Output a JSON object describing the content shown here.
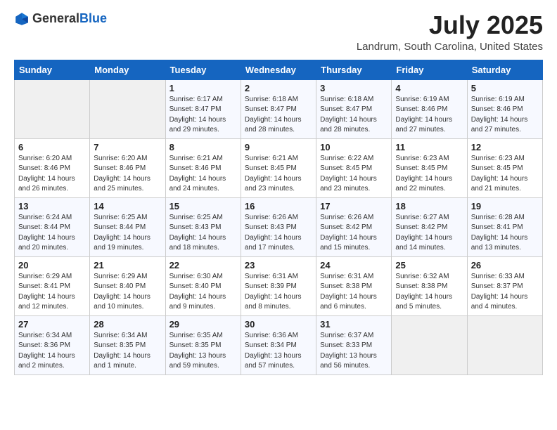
{
  "header": {
    "logo_general": "General",
    "logo_blue": "Blue",
    "month": "July 2025",
    "location": "Landrum, South Carolina, United States"
  },
  "days_of_week": [
    "Sunday",
    "Monday",
    "Tuesday",
    "Wednesday",
    "Thursday",
    "Friday",
    "Saturday"
  ],
  "weeks": [
    [
      {
        "day": "",
        "info": ""
      },
      {
        "day": "",
        "info": ""
      },
      {
        "day": "1",
        "info": "Sunrise: 6:17 AM\nSunset: 8:47 PM\nDaylight: 14 hours\nand 29 minutes."
      },
      {
        "day": "2",
        "info": "Sunrise: 6:18 AM\nSunset: 8:47 PM\nDaylight: 14 hours\nand 28 minutes."
      },
      {
        "day": "3",
        "info": "Sunrise: 6:18 AM\nSunset: 8:47 PM\nDaylight: 14 hours\nand 28 minutes."
      },
      {
        "day": "4",
        "info": "Sunrise: 6:19 AM\nSunset: 8:46 PM\nDaylight: 14 hours\nand 27 minutes."
      },
      {
        "day": "5",
        "info": "Sunrise: 6:19 AM\nSunset: 8:46 PM\nDaylight: 14 hours\nand 27 minutes."
      }
    ],
    [
      {
        "day": "6",
        "info": "Sunrise: 6:20 AM\nSunset: 8:46 PM\nDaylight: 14 hours\nand 26 minutes."
      },
      {
        "day": "7",
        "info": "Sunrise: 6:20 AM\nSunset: 8:46 PM\nDaylight: 14 hours\nand 25 minutes."
      },
      {
        "day": "8",
        "info": "Sunrise: 6:21 AM\nSunset: 8:46 PM\nDaylight: 14 hours\nand 24 minutes."
      },
      {
        "day": "9",
        "info": "Sunrise: 6:21 AM\nSunset: 8:45 PM\nDaylight: 14 hours\nand 23 minutes."
      },
      {
        "day": "10",
        "info": "Sunrise: 6:22 AM\nSunset: 8:45 PM\nDaylight: 14 hours\nand 23 minutes."
      },
      {
        "day": "11",
        "info": "Sunrise: 6:23 AM\nSunset: 8:45 PM\nDaylight: 14 hours\nand 22 minutes."
      },
      {
        "day": "12",
        "info": "Sunrise: 6:23 AM\nSunset: 8:45 PM\nDaylight: 14 hours\nand 21 minutes."
      }
    ],
    [
      {
        "day": "13",
        "info": "Sunrise: 6:24 AM\nSunset: 8:44 PM\nDaylight: 14 hours\nand 20 minutes."
      },
      {
        "day": "14",
        "info": "Sunrise: 6:25 AM\nSunset: 8:44 PM\nDaylight: 14 hours\nand 19 minutes."
      },
      {
        "day": "15",
        "info": "Sunrise: 6:25 AM\nSunset: 8:43 PM\nDaylight: 14 hours\nand 18 minutes."
      },
      {
        "day": "16",
        "info": "Sunrise: 6:26 AM\nSunset: 8:43 PM\nDaylight: 14 hours\nand 17 minutes."
      },
      {
        "day": "17",
        "info": "Sunrise: 6:26 AM\nSunset: 8:42 PM\nDaylight: 14 hours\nand 15 minutes."
      },
      {
        "day": "18",
        "info": "Sunrise: 6:27 AM\nSunset: 8:42 PM\nDaylight: 14 hours\nand 14 minutes."
      },
      {
        "day": "19",
        "info": "Sunrise: 6:28 AM\nSunset: 8:41 PM\nDaylight: 14 hours\nand 13 minutes."
      }
    ],
    [
      {
        "day": "20",
        "info": "Sunrise: 6:29 AM\nSunset: 8:41 PM\nDaylight: 14 hours\nand 12 minutes."
      },
      {
        "day": "21",
        "info": "Sunrise: 6:29 AM\nSunset: 8:40 PM\nDaylight: 14 hours\nand 10 minutes."
      },
      {
        "day": "22",
        "info": "Sunrise: 6:30 AM\nSunset: 8:40 PM\nDaylight: 14 hours\nand 9 minutes."
      },
      {
        "day": "23",
        "info": "Sunrise: 6:31 AM\nSunset: 8:39 PM\nDaylight: 14 hours\nand 8 minutes."
      },
      {
        "day": "24",
        "info": "Sunrise: 6:31 AM\nSunset: 8:38 PM\nDaylight: 14 hours\nand 6 minutes."
      },
      {
        "day": "25",
        "info": "Sunrise: 6:32 AM\nSunset: 8:38 PM\nDaylight: 14 hours\nand 5 minutes."
      },
      {
        "day": "26",
        "info": "Sunrise: 6:33 AM\nSunset: 8:37 PM\nDaylight: 14 hours\nand 4 minutes."
      }
    ],
    [
      {
        "day": "27",
        "info": "Sunrise: 6:34 AM\nSunset: 8:36 PM\nDaylight: 14 hours\nand 2 minutes."
      },
      {
        "day": "28",
        "info": "Sunrise: 6:34 AM\nSunset: 8:35 PM\nDaylight: 14 hours\nand 1 minute."
      },
      {
        "day": "29",
        "info": "Sunrise: 6:35 AM\nSunset: 8:35 PM\nDaylight: 13 hours\nand 59 minutes."
      },
      {
        "day": "30",
        "info": "Sunrise: 6:36 AM\nSunset: 8:34 PM\nDaylight: 13 hours\nand 57 minutes."
      },
      {
        "day": "31",
        "info": "Sunrise: 6:37 AM\nSunset: 8:33 PM\nDaylight: 13 hours\nand 56 minutes."
      },
      {
        "day": "",
        "info": ""
      },
      {
        "day": "",
        "info": ""
      }
    ]
  ]
}
